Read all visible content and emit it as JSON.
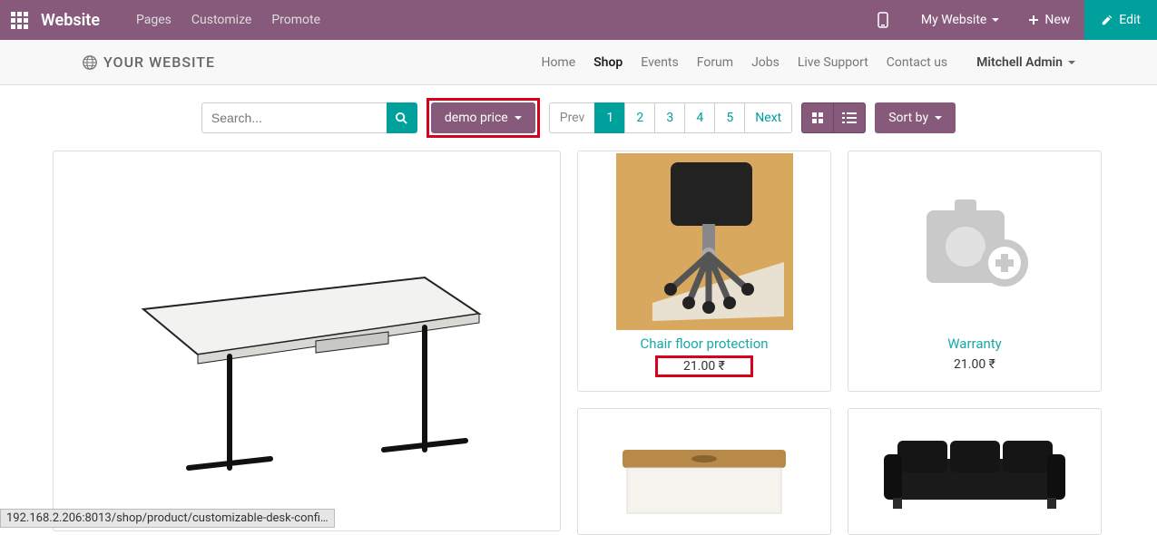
{
  "topbar": {
    "brand": "Website",
    "menu": [
      "Pages",
      "Customize",
      "Promote"
    ],
    "my_website": "My Website",
    "new": "New",
    "edit": "Edit"
  },
  "subheader": {
    "site_name": "YOUR WEBSITE",
    "nav": [
      "Home",
      "Shop",
      "Events",
      "Forum",
      "Jobs",
      "Live Support",
      "Contact us"
    ],
    "active": "Shop",
    "user": "Mitchell Admin"
  },
  "toolbar": {
    "search_placeholder": "Search...",
    "pricelist": "demo price",
    "pages": {
      "prev": "Prev",
      "items": [
        "1",
        "2",
        "3",
        "4",
        "5"
      ],
      "next": "Next",
      "active": "1"
    },
    "sortby": "Sort by"
  },
  "products": {
    "chair": {
      "title": "Chair floor protection",
      "price": "21.00 ₹"
    },
    "warranty": {
      "title": "Warranty",
      "price": "21.00 ₹"
    }
  },
  "status_url": "192.168.2.206:8013/shop/product/customizable-desk-confi…"
}
